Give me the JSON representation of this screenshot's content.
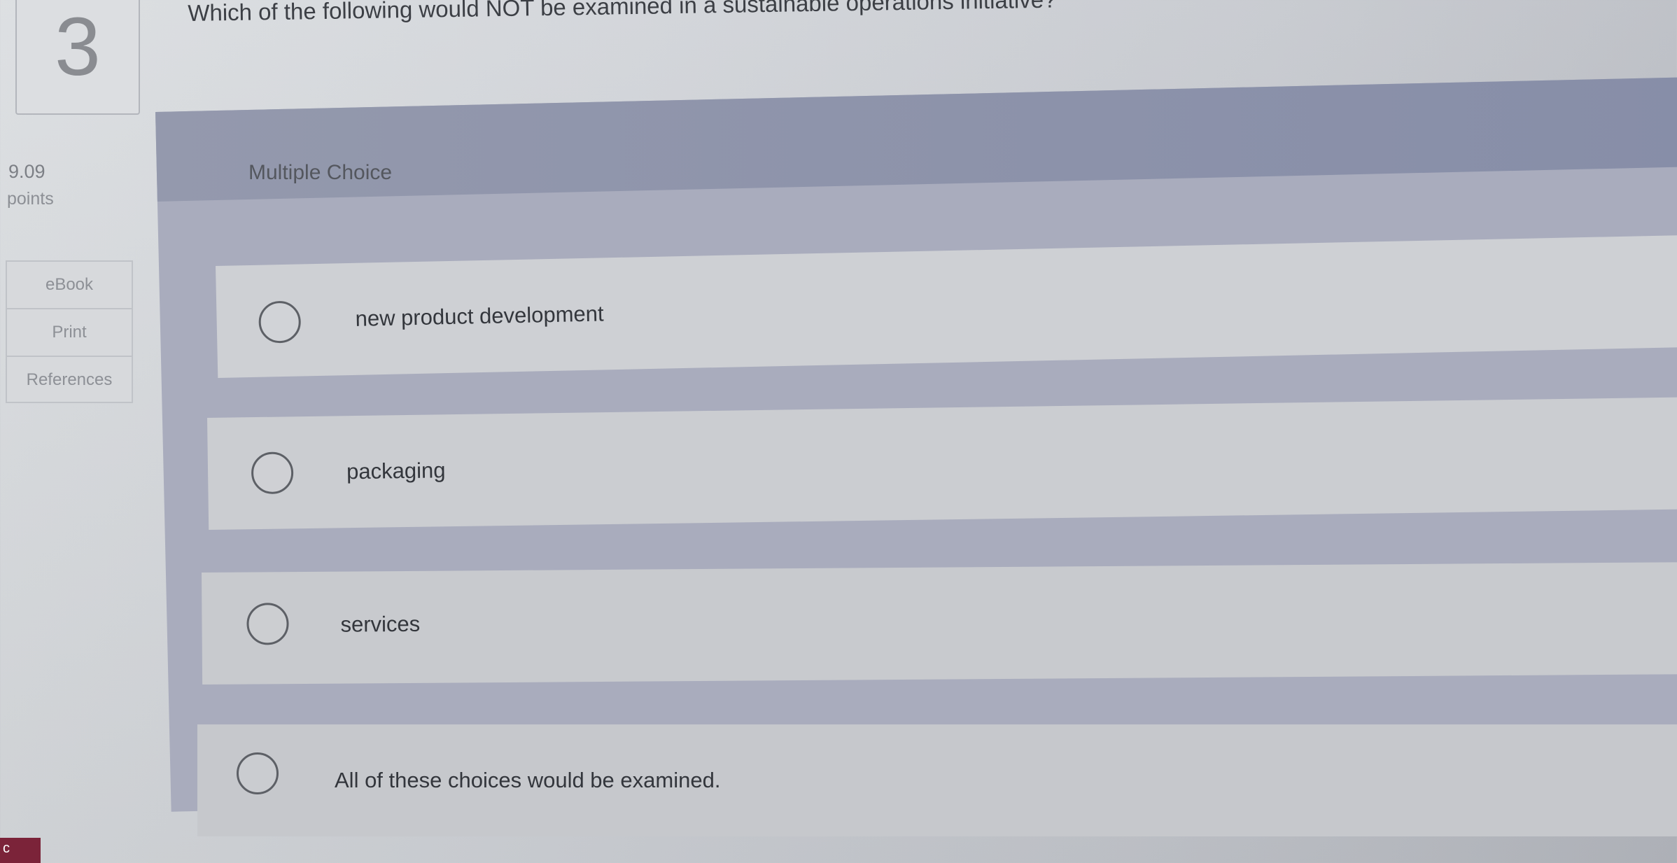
{
  "question": {
    "number": "3",
    "text": "Which of the following would NOT be examined in a sustainable operations initiative?"
  },
  "points": {
    "value": "9.09",
    "label": "points"
  },
  "tools": [
    "eBook",
    "Print",
    "References"
  ],
  "question_type": "Multiple Choice",
  "options": [
    "new product development",
    "packaging",
    "services",
    "All of these choices would be examined."
  ],
  "corner_tab": {
    "label": "c"
  }
}
